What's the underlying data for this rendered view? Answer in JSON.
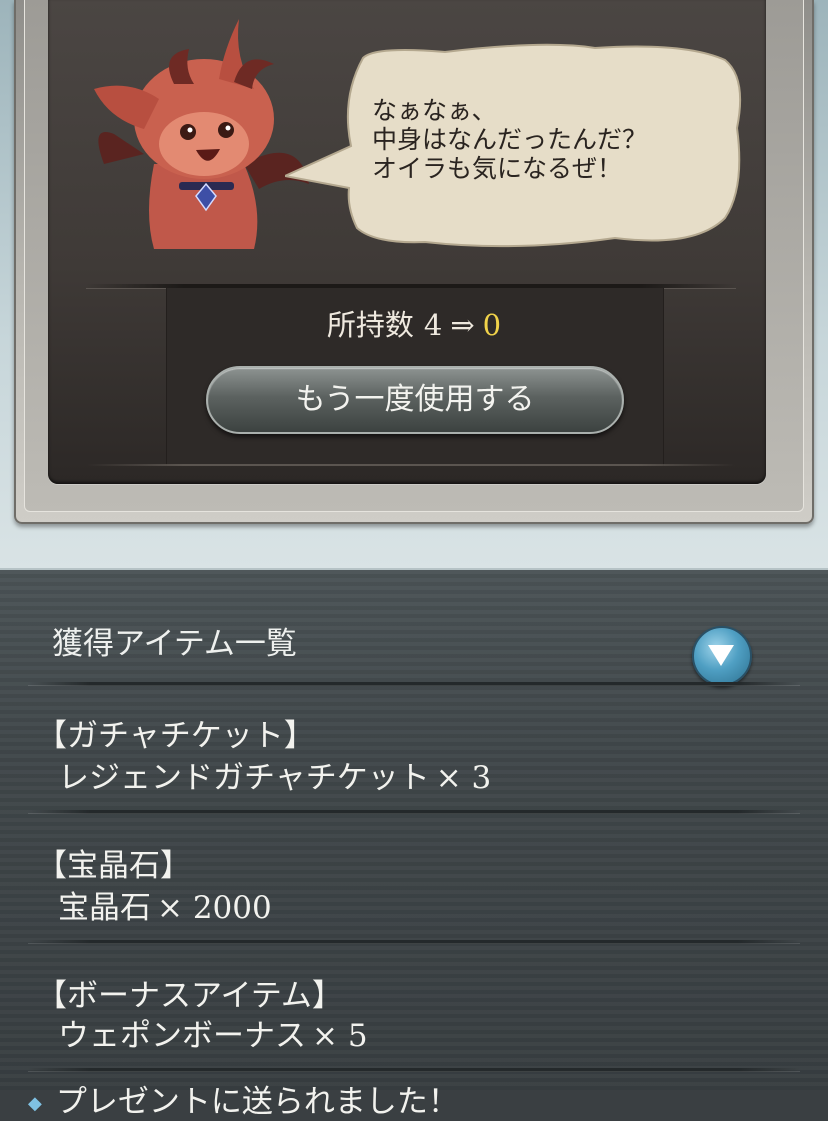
{
  "dialog": {
    "speech": "なぁなぁ、\n中身はなんだったんだ？\nオイラも気になるぜ！",
    "count_label": "所持数",
    "count_before": "4",
    "count_arrow": "⇒",
    "count_after": "0",
    "use_again_label": "もう一度使用する"
  },
  "list": {
    "title": "獲得アイテム一覧",
    "expand_icon": "chevron-down-icon",
    "sections": [
      {
        "category": "【ガチャチケット】",
        "item": "レジェンドガチャチケット",
        "qty": "× 3"
      },
      {
        "category": "【宝晶石】",
        "item": "宝晶石",
        "qty": "× 2000"
      },
      {
        "category": "【ボーナスアイテム】",
        "item": "ウェポンボーナス",
        "qty": "× 5"
      }
    ],
    "footer_note": "プレゼントに送られました！"
  },
  "colors": {
    "accent_count": "#f0d24a",
    "expand_button": "#4f9fc3"
  }
}
